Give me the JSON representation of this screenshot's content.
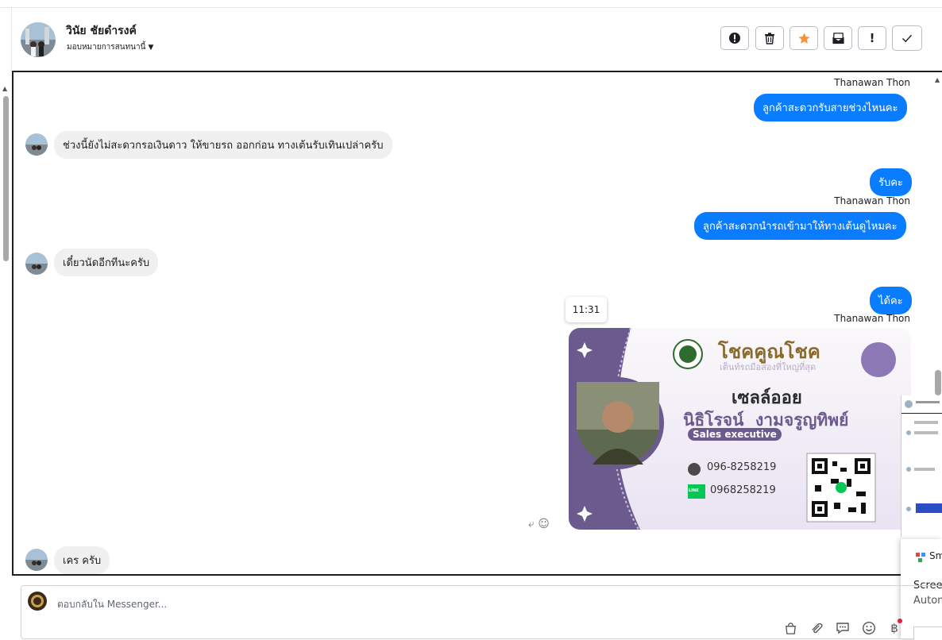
{
  "header": {
    "contact_name": "วินัย ชัยดำรงค์",
    "assign_label": "มอบหมายการสนทนานี้",
    "toolbar": [
      {
        "name": "spam-button",
        "icon": "alert-circle-icon"
      },
      {
        "name": "delete-button",
        "icon": "trash-icon"
      },
      {
        "name": "star-button",
        "icon": "star-icon"
      },
      {
        "name": "mark-unread-button",
        "icon": "envelope-icon"
      },
      {
        "name": "follow-up-button",
        "icon": "exclamation-icon"
      },
      {
        "name": "done-button",
        "icon": "check-icon"
      }
    ]
  },
  "messages": {
    "m1_sender": "Thanawan Thon",
    "m1_text": "ลูกค้าสะดวกรับสายช่วงไหนคะ",
    "m2_text": "ช่วงนี้ยังไม่สะดวกรอเงินดาว ให้ขายรถ ออกก่อน ทางเต้นรับเทินเปล่าครับ",
    "m3_text": "รับคะ",
    "m4_sender": "Thanawan Thon",
    "m4_text": "ลูกค้าสะดวกนำรถเข้ามาให้ทางเต้นดูไหมคะ",
    "m5_text": "เดี๋ยวนัดอีกทีนะครับ",
    "m6_text": "ได้คะ",
    "m7_sender": "Thanawan Thon",
    "tooltip_time": "11:31",
    "m8_text": "เคร ครับ"
  },
  "card": {
    "brand": "โชคคูณโชค",
    "tagline": "เต็นท์รถมือสองที่ใหญ่ที่สุด",
    "title": "เซลล์ออย",
    "person_name": "นิธิโรจน์  งามจรูญทิพย์",
    "role": "Sales executive",
    "phone": "096-8258219",
    "line_badge": "LINE",
    "line_id": "0968258219"
  },
  "side_panel": {
    "smart_label": "Sm",
    "screen_label": "Screen",
    "auto_label": "Autom"
  },
  "composer": {
    "placeholder": "ตอบกลับใน Messenger...",
    "icons": [
      "bag-icon",
      "attachment-icon",
      "comment-icon",
      "emoji-icon",
      "baht-icon"
    ]
  },
  "colors": {
    "accent": "#0a7cff",
    "star": "#f7923a",
    "card_purple": "#6b5a8e",
    "line_green": "#06c755"
  }
}
